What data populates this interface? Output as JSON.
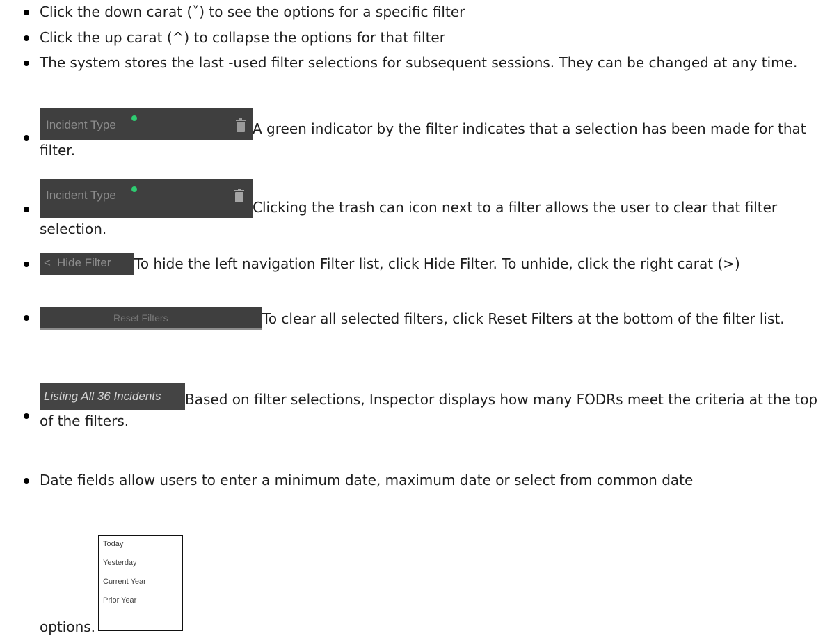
{
  "bullets": [
    {
      "text": "Click the down carat (˅) to see the options for a specific filter"
    },
    {
      "text": "Click the up carat (^) to collapse the options for that filter"
    },
    {
      "text": "The system stores the last -used filter selections for subsequent sessions. They can be changed at any time."
    },
    {
      "shot_label": "Incident Type",
      "text": "A green indicator by the filter indicates that a selection has been made for that filter."
    },
    {
      "shot_label": "Incident Type",
      "text": "Clicking the trash can icon next to a filter allows the user to clear that filter selection."
    },
    {
      "shot_label": "Hide Filter",
      "text": "To hide the left navigation Filter list, click Hide Filter. To unhide, click the right carat (>)"
    },
    {
      "shot_label": "Reset Filters",
      "text": "To clear all selected filters, click Reset Filters at the bottom of the filter list."
    },
    {
      "shot_label": "Listing All 36 Incidents",
      "text": "Based on filter selections, Inspector displays how many FODRs meet the criteria at the top of the filters."
    },
    {
      "text": "Date fields allow users to enter a minimum date, maximum date or select from common date",
      "text_end": "options."
    }
  ],
  "date_options": [
    "Today",
    "Yesterday",
    "Current Year",
    "Prior Year"
  ],
  "colors": {
    "indicator": "#2ecc71",
    "shot_bg": "#3f3f3f",
    "shot_text": "#8c8c8c"
  },
  "icons": [
    "trash-icon",
    "chevron-left-icon"
  ]
}
